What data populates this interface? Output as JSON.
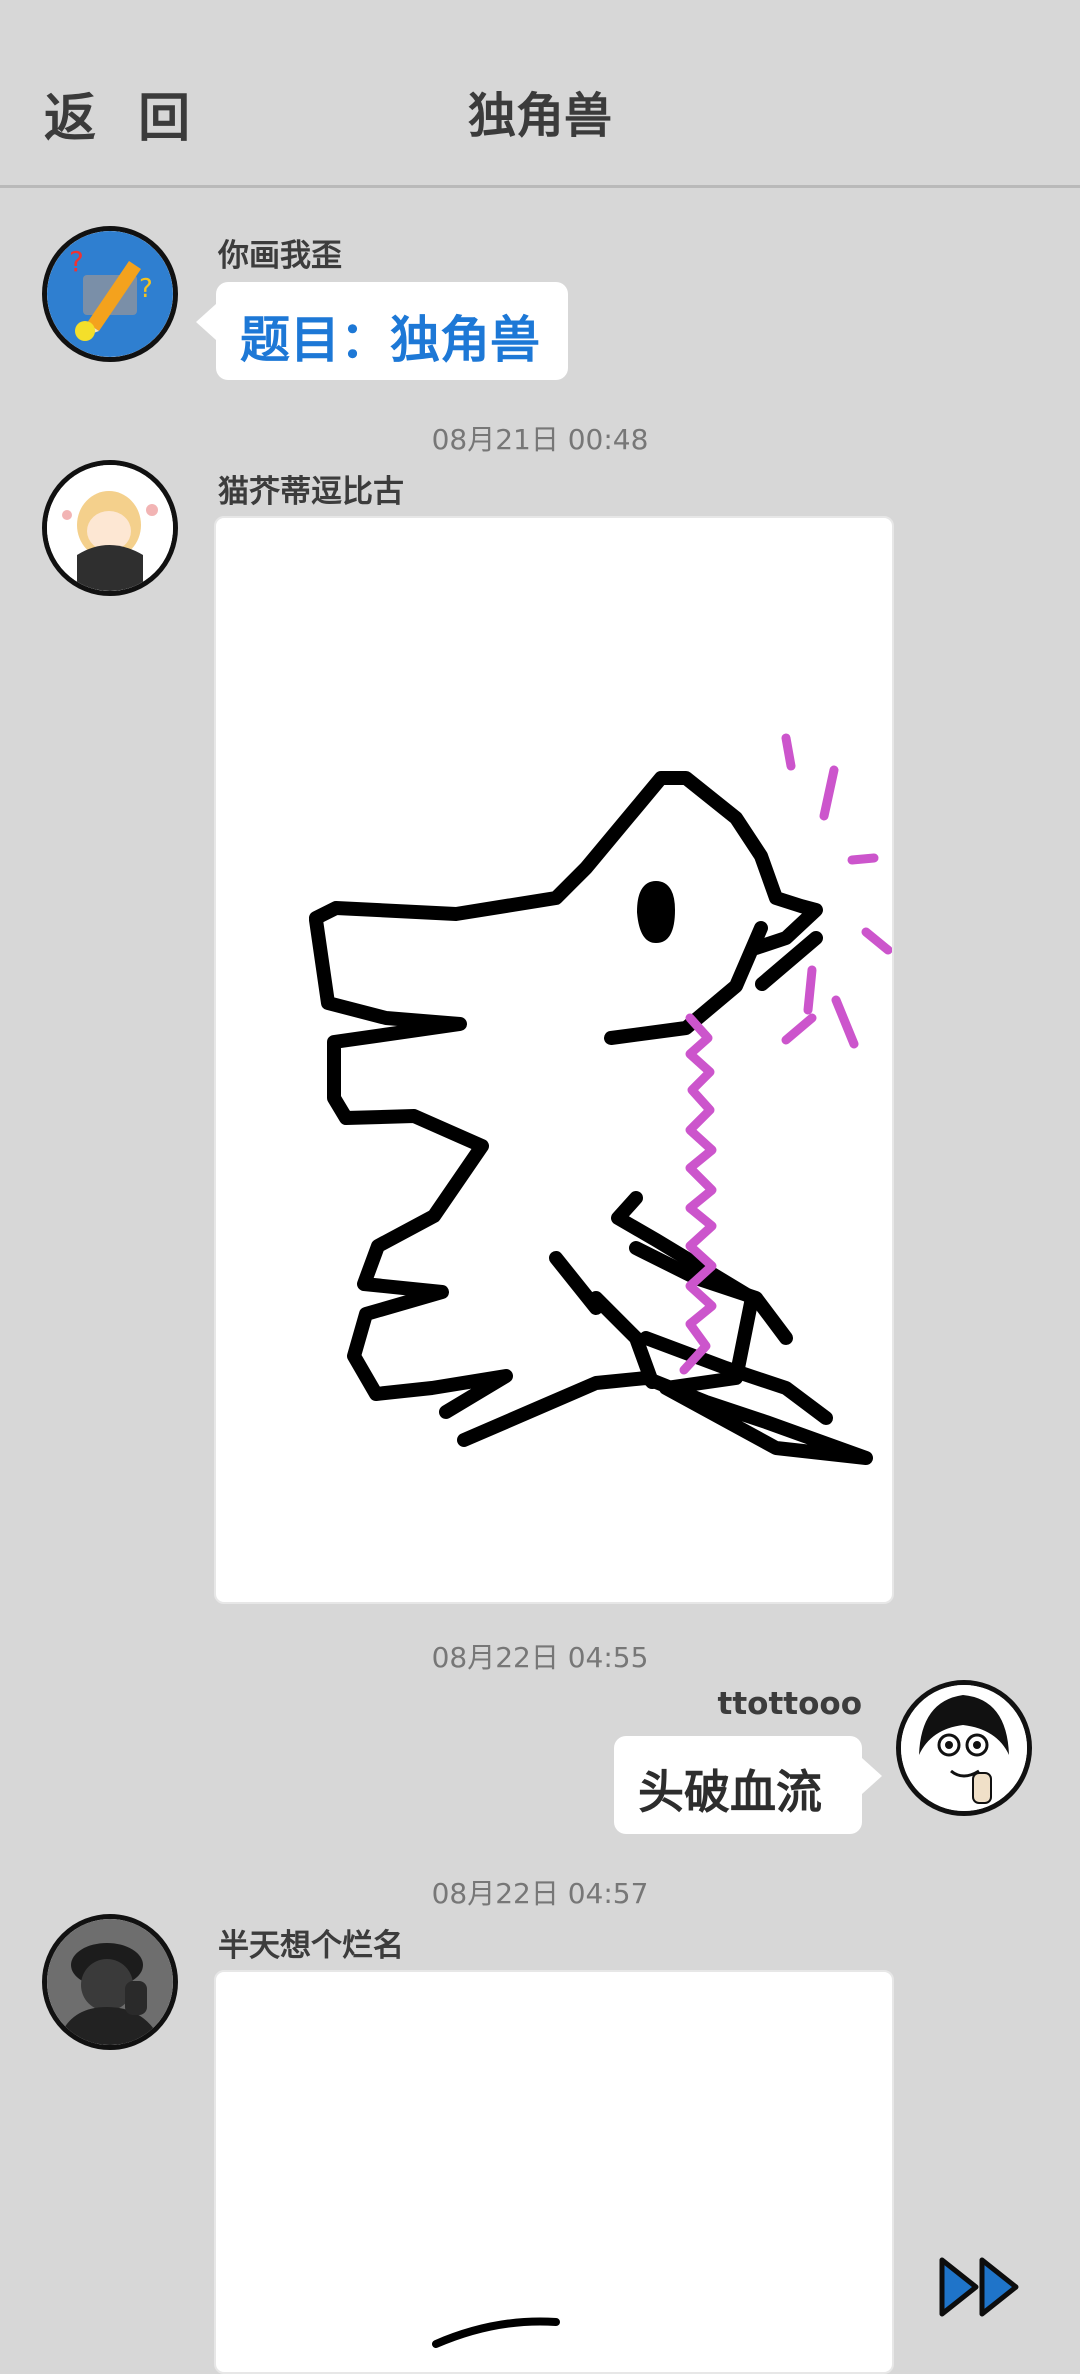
{
  "header": {
    "back_label": "返 回",
    "title": "独角兽"
  },
  "messages": {
    "m1": {
      "name": "你画我歪",
      "text": "题目：独角兽"
    },
    "t1": "08月21日  00:48",
    "m2": {
      "name": "猫芥蒂逗比古"
    },
    "t2": "08月22日  04:55",
    "m3": {
      "name": "ttottooo",
      "text": "头破血流"
    },
    "t3": "08月22日  04:57",
    "m4": {
      "name": "半天想个烂名"
    }
  },
  "colors": {
    "accent_blue": "#1d78d6",
    "stroke_purple": "#cc55cc"
  },
  "icons": {
    "fast_forward": "fast-forward-icon"
  }
}
